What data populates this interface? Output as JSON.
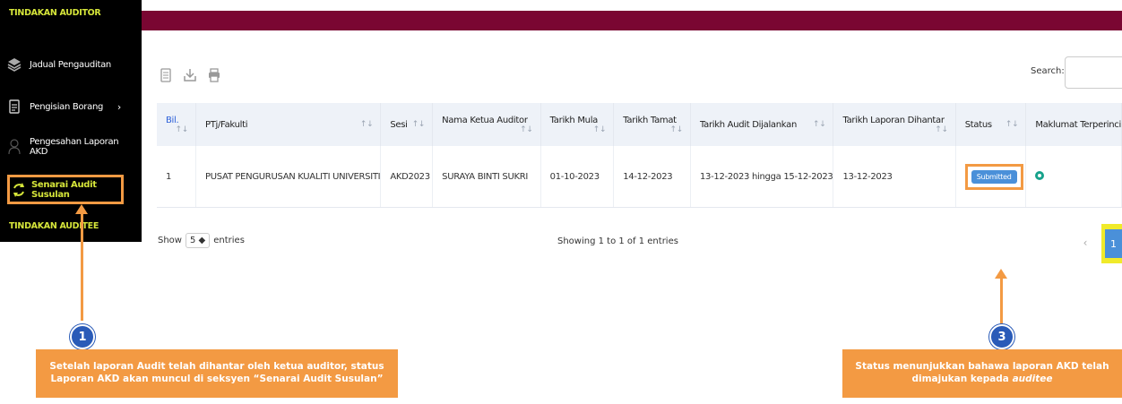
{
  "sidebar": {
    "section_auditor": "TINDAKAN AUDITOR",
    "items": [
      {
        "label": "Jadual Pengauditan",
        "icon": "layers-icon"
      },
      {
        "label": "Pengisian Borang",
        "icon": "document-icon",
        "chevron": "›"
      },
      {
        "label": "Pengesahan Laporan AKD",
        "icon": "user-icon"
      },
      {
        "label": "Senarai Audit Susulan",
        "icon": "refresh-icon"
      }
    ],
    "section_auditee": "TINDAKAN AUDITEE"
  },
  "toolbar": {
    "icons": [
      "list-icon",
      "download-icon",
      "print-icon"
    ]
  },
  "search": {
    "label": "Search:",
    "value": ""
  },
  "table": {
    "headers": [
      "Bil.",
      "PTj/Fakulti",
      "Sesi",
      "Nama Ketua Auditor",
      "Tarikh Mula",
      "Tarikh Tamat",
      "Tarikh Audit Dijalankan",
      "Tarikh Laporan Dihantar",
      "Status",
      "Maklumat Terperinci"
    ],
    "rows": [
      {
        "bil": "1",
        "ptj": "PUSAT PENGURUSAN KUALITI UNIVERSITI",
        "sesi": "AKD2023",
        "ketua": "SURAYA BINTI SUKRI",
        "mula": "01-10-2023",
        "tamat": "14-12-2023",
        "dijalankan": "13-12-2023 hingga 15-12-2023",
        "dihantar": "13-12-2023",
        "status": "Submitted"
      }
    ]
  },
  "footer": {
    "show": "Show",
    "entries_value": "5",
    "entries": "entries",
    "showing": "Showing 1 to 1 of 1 entries",
    "prev": "‹",
    "page": "1"
  },
  "callouts": [
    {
      "number": "1",
      "text_line1": "Setelah laporan Audit telah dihantar oleh ketua auditor, status",
      "text_line2": "Laporan AKD akan muncul di seksyen  “Senarai Audit Susulan”"
    },
    {
      "number": "3",
      "text_line1": "Status menunjukkan bahawa laporan AKD telah",
      "text_line2_pre": "dimajukan kepada ",
      "text_line2_em": "auditee"
    }
  ],
  "colors": {
    "topbar": "#7a0632",
    "accent": "#f39a43",
    "badge": "#4a90d9",
    "sidebar_highlight": "#d6e63a"
  }
}
